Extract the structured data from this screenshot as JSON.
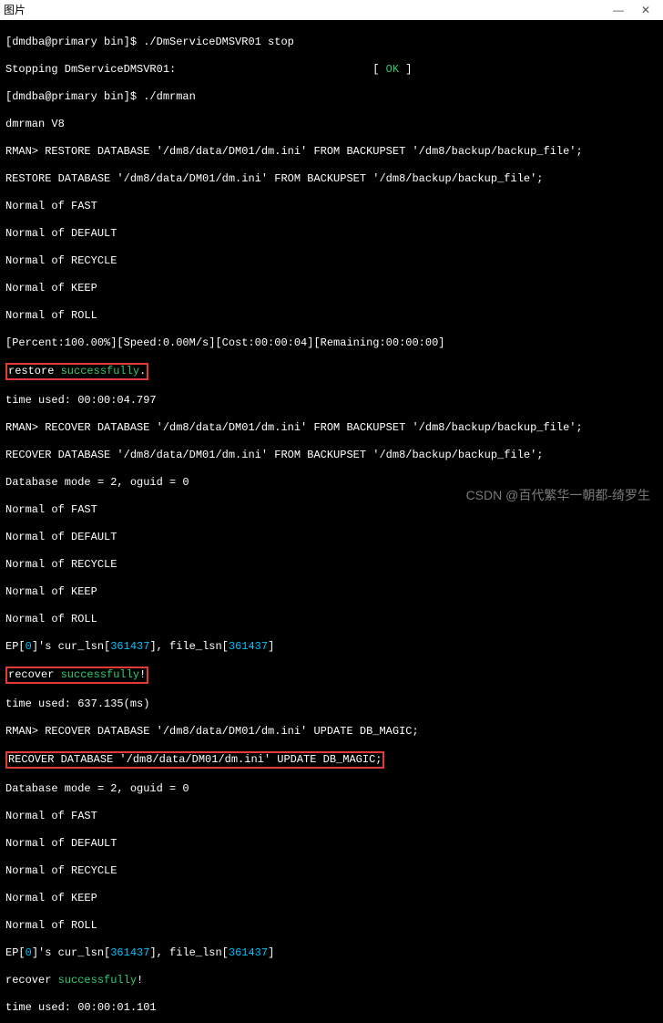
{
  "window": {
    "title": "图片",
    "minimize": "—",
    "close": "✕"
  },
  "term": {
    "l0": "[dmdba@primary bin]$ ./DmServiceDMSVR01 stop",
    "l1a": "Stopping DmServiceDMSVR01:                              [ ",
    "l1_ok": "OK",
    "l1b": " ]",
    "l2": "[dmdba@primary bin]$ ./dmrman",
    "l3": "dmrman V8",
    "l4": "RMAN> RESTORE DATABASE '/dm8/data/DM01/dm.ini' FROM BACKUPSET '/dm8/backup/backup_file';",
    "l5": "RESTORE DATABASE '/dm8/data/DM01/dm.ini' FROM BACKUPSET '/dm8/backup/backup_file';",
    "l6": "Normal of FAST",
    "l7": "Normal of DEFAULT",
    "l8": "Normal of RECYCLE",
    "l9": "Normal of KEEP",
    "l10": "Normal of ROLL",
    "l11": "[Percent:100.00%][Speed:0.00M/s][Cost:00:00:04][Remaining:00:00:00]",
    "l12a": "restore ",
    "l12b": "successfully",
    "l12c": ".",
    "l13": "time used: 00:00:04.797",
    "l14": "RMAN> RECOVER DATABASE '/dm8/data/DM01/dm.ini' FROM BACKUPSET '/dm8/backup/backup_file';",
    "l15": "RECOVER DATABASE '/dm8/data/DM01/dm.ini' FROM BACKUPSET '/dm8/backup/backup_file';",
    "l16": "Database mode = 2, oguid = 0",
    "l17": "Normal of FAST",
    "l18": "Normal of DEFAULT",
    "l19": "Normal of RECYCLE",
    "l20": "Normal of KEEP",
    "l21": "Normal of ROLL",
    "l22a": "EP[",
    "l22b": "0",
    "l22c": "]'s cur_lsn[",
    "l22d": "361437",
    "l22e": "], file_lsn[",
    "l22f": "361437",
    "l22g": "]",
    "l23a": "recover ",
    "l23b": "successfully",
    "l23c": "!",
    "l24": "time used: 637.135(ms)",
    "l25": "RMAN> RECOVER DATABASE '/dm8/data/DM01/dm.ini' UPDATE DB_MAGIC;",
    "l26": "RECOVER DATABASE '/dm8/data/DM01/dm.ini' UPDATE DB_MAGIC;",
    "l27": "Database mode = 2, oguid = 0",
    "l28": "Normal of FAST",
    "l29": "Normal of DEFAULT",
    "l30": "Normal of RECYCLE",
    "l31": "Normal of KEEP",
    "l32": "Normal of ROLL",
    "l33a": "EP[",
    "l33b": "0",
    "l33c": "]'s cur_lsn[",
    "l33d": "361437",
    "l33e": "], file_lsn[",
    "l33f": "361437",
    "l33g": "]",
    "l34a": "recover ",
    "l34b": "successfully",
    "l34c": "!",
    "l35": "time used: 00:00:01.101"
  },
  "watermark": "CSDN @百代繁华一朝都-绮罗生"
}
